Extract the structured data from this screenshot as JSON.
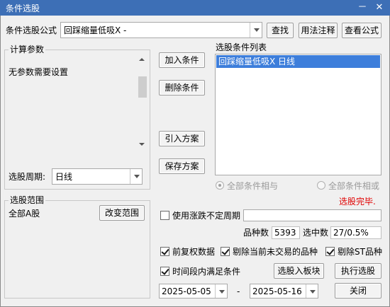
{
  "window": {
    "title": "条件选股",
    "minimize_label": "－",
    "close_label": "✕"
  },
  "formula": {
    "label": "条件选股公式",
    "value": "回踩缩量低吸X -",
    "find_button": "查找",
    "usage_button": "用法注释",
    "view_button": "查看公式"
  },
  "params": {
    "group_title": "计算参数",
    "message": "无参数需要设置"
  },
  "period": {
    "label": "选股周期:",
    "value": "日线"
  },
  "actions": {
    "add": "加入条件",
    "delete": "删除条件",
    "import": "引入方案",
    "save": "保存方案"
  },
  "conditions": {
    "title": "选股条件列表",
    "items": [
      "回踩缩量低吸X  日线"
    ]
  },
  "logic": {
    "and_label": "全部条件相与",
    "or_label": "全部条件相或"
  },
  "status": {
    "message": "选股完毕.",
    "color": "#e00000"
  },
  "scope": {
    "group_title": "选股范围",
    "value": "全部A股",
    "change_button": "改变范围"
  },
  "options": {
    "variable_period_label": "使用涨跌不定周期",
    "variable_period_checked": false,
    "total_label": "品种数",
    "total_value": "5393",
    "hit_label": "选中数",
    "hit_value": "27/0.5%",
    "adjusted_label": "前复权数据",
    "adjusted_checked": true,
    "exclude_untraded_label": "剔除当前未交易的品种",
    "exclude_untraded_checked": true,
    "exclude_st_label": "剔除ST品种",
    "exclude_st_checked": true,
    "time_range_label": "时间段内满足条件",
    "time_range_checked": true
  },
  "dates": {
    "start": "2025-05-05",
    "separator": "-",
    "end": "2025-05-16"
  },
  "bottom": {
    "to_block_button": "选股入板块",
    "run_button": "执行选股",
    "close_button": "关闭"
  },
  "colors": {
    "titlebar": "#3d6fb6",
    "selection": "#3d7edb",
    "accent": "#e00000"
  }
}
